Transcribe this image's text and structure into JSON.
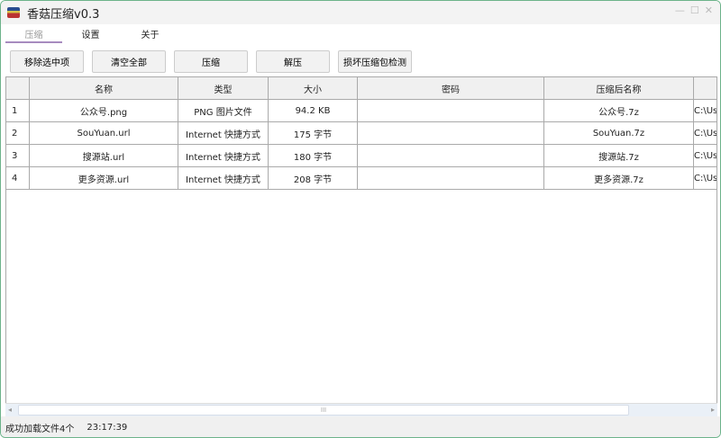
{
  "window": {
    "title": "香菇压缩v0.3",
    "controls": [
      "—",
      "☐",
      "✕"
    ]
  },
  "tabs": [
    {
      "label": "压缩",
      "active": true
    },
    {
      "label": "设置"
    },
    {
      "label": "关于"
    }
  ],
  "toolbar": {
    "remove": "移除选中项",
    "clear": "清空全部",
    "compress": "压缩",
    "extract": "解压",
    "check": "损坏压缩包检测"
  },
  "table": {
    "headers": [
      "",
      "名称",
      "类型",
      "大小",
      "密码",
      "压缩后名称",
      ""
    ],
    "rows": [
      [
        "1",
        "公众号.png",
        "PNG 图片文件",
        "94.2 KB",
        "",
        "公众号.7z",
        "C:\\Us"
      ],
      [
        "2",
        "SouYuan.url",
        "Internet 快捷方式",
        "175 字节",
        "",
        "SouYuan.7z",
        "C:\\Us"
      ],
      [
        "3",
        "搜源站.url",
        "Internet 快捷方式",
        "180 字节",
        "",
        "搜源站.7z",
        "C:\\Us"
      ],
      [
        "4",
        "更多资源.url",
        "Internet 快捷方式",
        "208 字节",
        "",
        "更多资源.7z",
        "C:\\Us"
      ]
    ]
  },
  "scrollbar": {
    "grip": "III"
  },
  "status": {
    "message": "成功加载文件4个",
    "time": "23:17:39"
  }
}
